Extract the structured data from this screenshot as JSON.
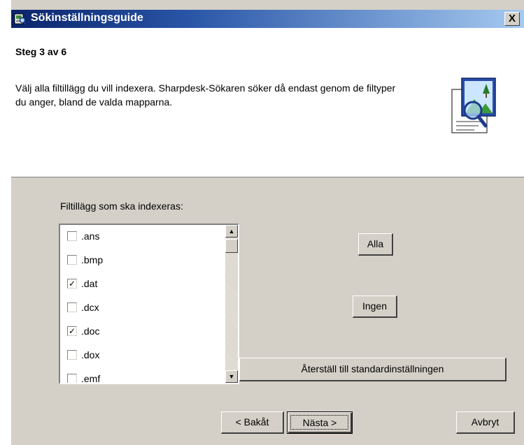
{
  "window": {
    "title": "Sökinställningsguide",
    "close_glyph": "X",
    "icon": "search-wizard-icon"
  },
  "header": {
    "step_title": "Steg 3 av 6",
    "description": "Välj alla filtillägg du vill indexera. Sharpdesk-Sökaren söker då endast genom de filtyper du anger, bland de valda mapparna.",
    "graphic": "document-magnifier-graphic"
  },
  "main": {
    "list_label": "Filtillägg som ska indexeras:",
    "extensions": [
      {
        "label": ".ans",
        "checked": false
      },
      {
        "label": ".bmp",
        "checked": false
      },
      {
        "label": ".dat",
        "checked": true
      },
      {
        "label": ".dcx",
        "checked": false
      },
      {
        "label": ".doc",
        "checked": true
      },
      {
        "label": ".dox",
        "checked": false
      },
      {
        "label": ".emf",
        "checked": false
      }
    ],
    "all_label": "Alla",
    "none_label": "Ingen",
    "reset_label": "Återställ till standardinställningen"
  },
  "footer": {
    "back_label": "< Bakåt",
    "next_label": "Nästa >",
    "cancel_label": "Avbryt"
  },
  "colors": {
    "titlebar_start": "#0a246a",
    "titlebar_end": "#a6caf0",
    "dialog_face": "#d4d0c8"
  }
}
